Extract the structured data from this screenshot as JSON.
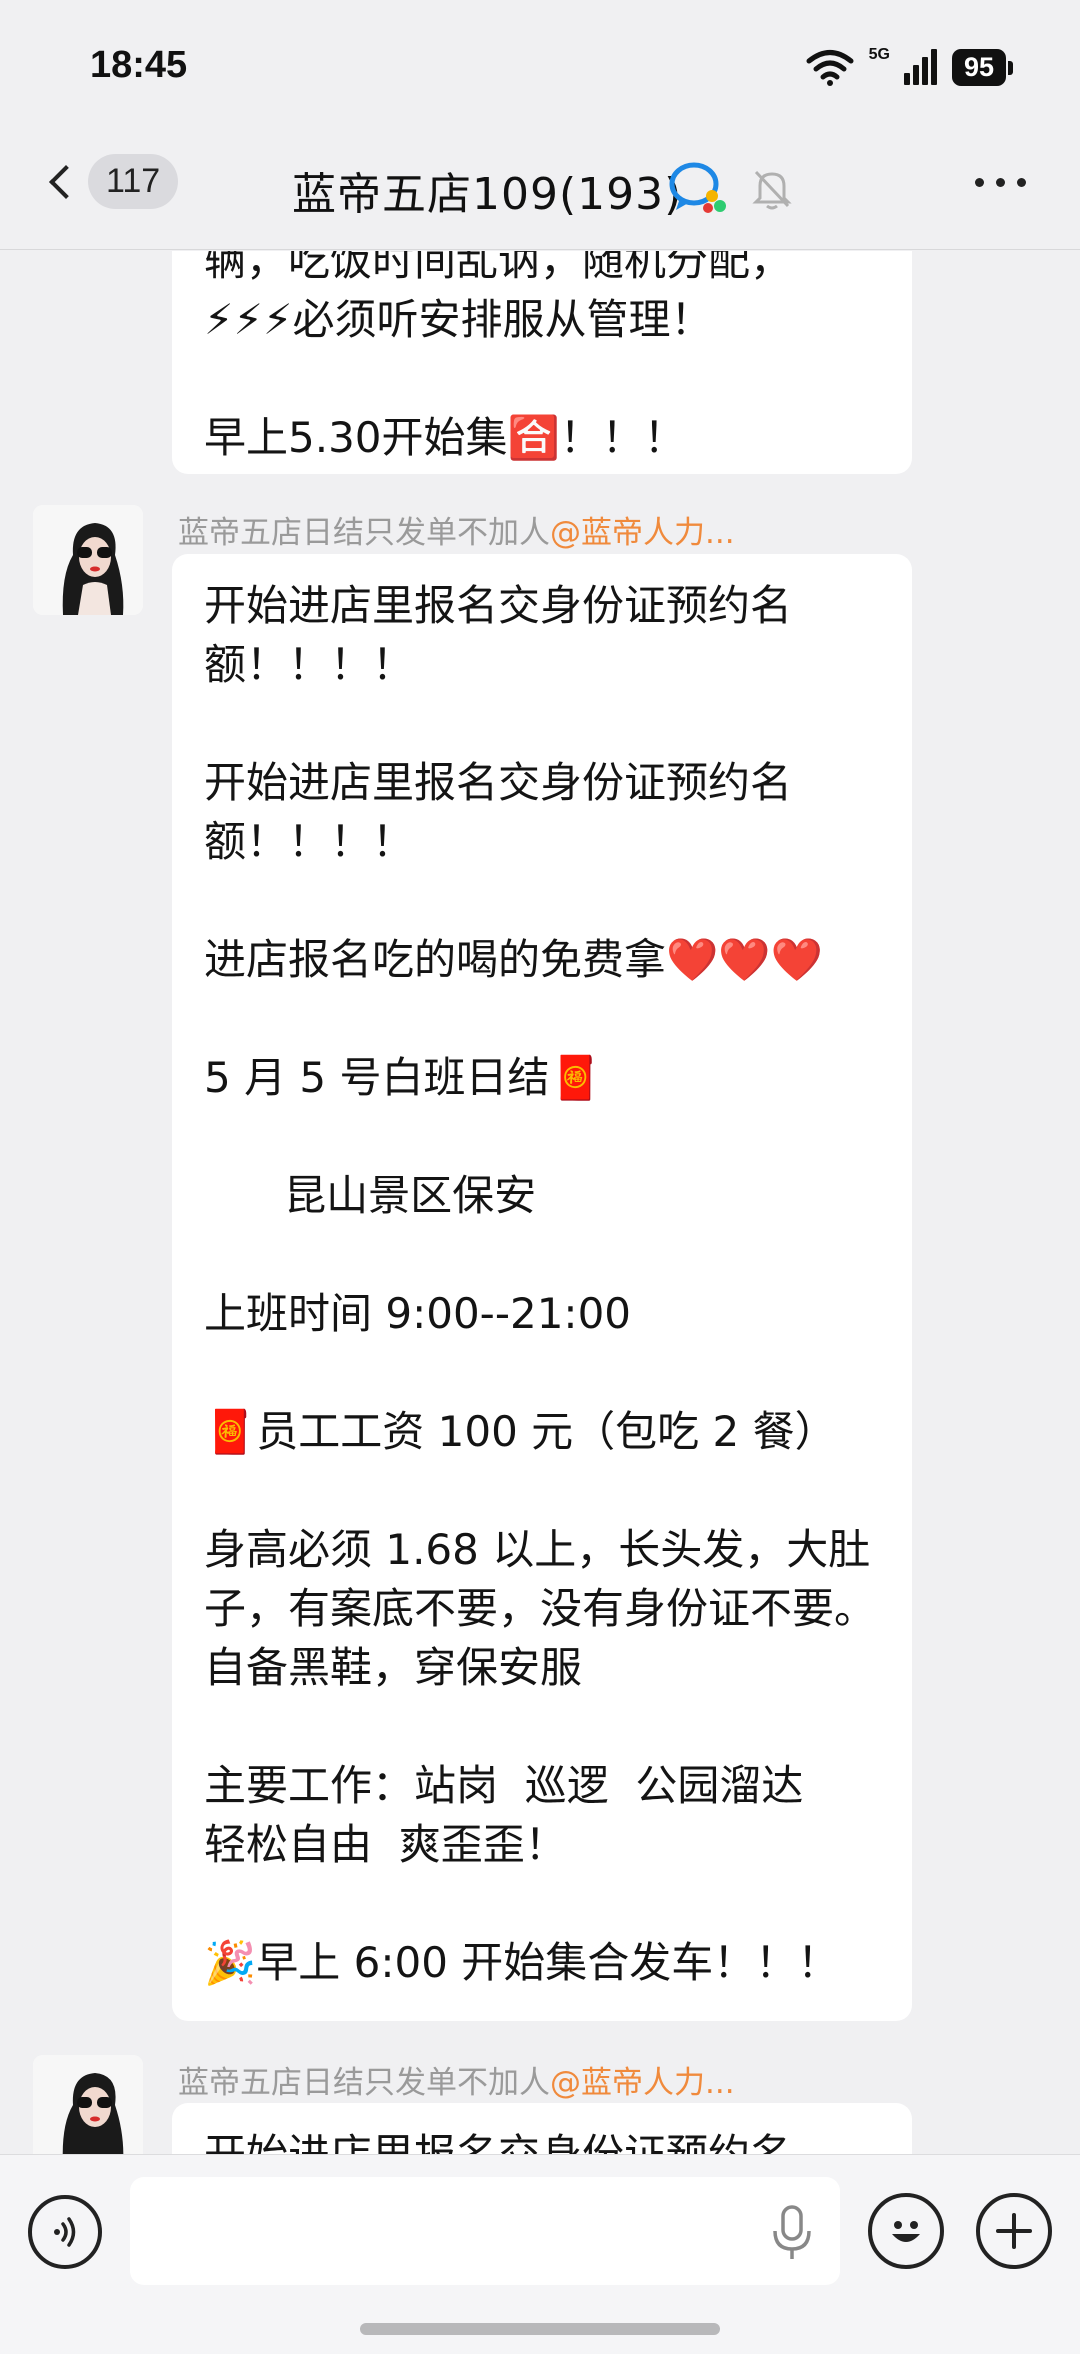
{
  "status_bar": {
    "time": "18:45",
    "network": "5G",
    "battery": "95"
  },
  "header": {
    "back_icon": "chevron-left-icon",
    "unread_count": "117",
    "title": "蓝帝五店109(193)",
    "verified_icon": "group-chat-icon",
    "mute_icon": "bell-muted-icon",
    "more_icon": "more-dots-icon"
  },
  "messages": [
    {
      "partial_top": true,
      "lines": [
        "辆，吃饭时间乱讷，随机分配，",
        "⚡⚡⚡必须听安排服从管理！",
        "",
        "早上5.30开始集🈴！！！"
      ]
    },
    {
      "sender_name": "蓝帝五店日结只发单不加人",
      "sender_mention": "@蓝帝人力...",
      "lines": [
        "开始进店里报名交身份证预约名",
        "额！！！！",
        "",
        "开始进店里报名交身份证预约名",
        "额！！！！",
        "",
        "进店报名吃的喝的免费拿❤️❤️❤️",
        "",
        "5 月 5 号白班日结🧧",
        "",
        "      昆山景区保安",
        "",
        "上班时间 9:00--21:00",
        "",
        "🧧员工工资 100 元（包吃 2 餐）",
        "",
        "身高必须 1.68 以上，长头发，大肚",
        "子，有案底不要，没有身份证不要。",
        "自备黑鞋，穿保安服",
        "",
        "主要工作：站岗  巡逻  公园溜达",
        "轻松自由  爽歪歪！",
        "",
        "🎉早上 6:00 开始集合发车！！！"
      ]
    },
    {
      "sender_name": "蓝帝五店日结只发单不加人",
      "sender_mention": "@蓝帝人力...",
      "partial_bottom": true,
      "lines": [
        "开始进店里报名交身份证预约名"
      ]
    }
  ],
  "input_bar": {
    "voice_icon": "voice-mode-icon",
    "placeholder": "",
    "mic_icon": "microphone-icon",
    "emoji_icon": "emoji-icon",
    "plus_icon": "plus-icon"
  },
  "colors": {
    "mention": "#f08a3c",
    "background": "#f0f0f2",
    "bubble": "#ffffff"
  }
}
